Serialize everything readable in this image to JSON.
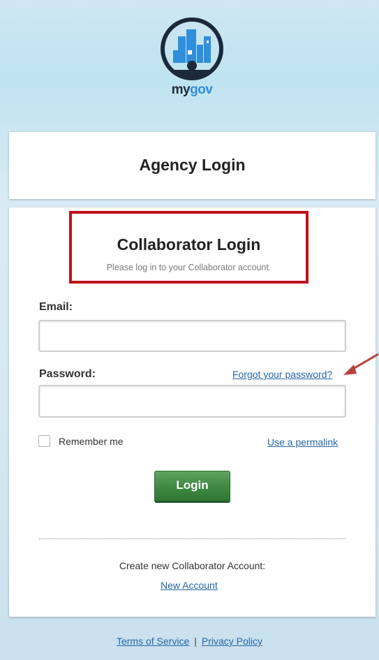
{
  "brand": {
    "logo_my": "my",
    "logo_gov": "gov"
  },
  "agency": {
    "title": "Agency Login"
  },
  "collaborator": {
    "title": "Collaborator Login",
    "subtitle": "Please log in to your Collaborator account."
  },
  "form": {
    "email_label": "Email:",
    "email_value": "",
    "password_label": "Password:",
    "password_value": "",
    "forgot_link": "Forgot your password?",
    "remember_label": "Remember me",
    "remember_checked": false,
    "permalink_link": "Use a permalink",
    "login_button": "Login"
  },
  "signup": {
    "prompt": "Create new Collaborator Account:",
    "link": "New Account"
  },
  "footer": {
    "terms": "Terms of Service",
    "separator": "|",
    "privacy": "Privacy Policy"
  },
  "colors": {
    "highlight_box": "#c0111a",
    "annotation_arrow": "#b5413a",
    "button_green": "#3f8842",
    "link_blue": "#2466a6"
  }
}
